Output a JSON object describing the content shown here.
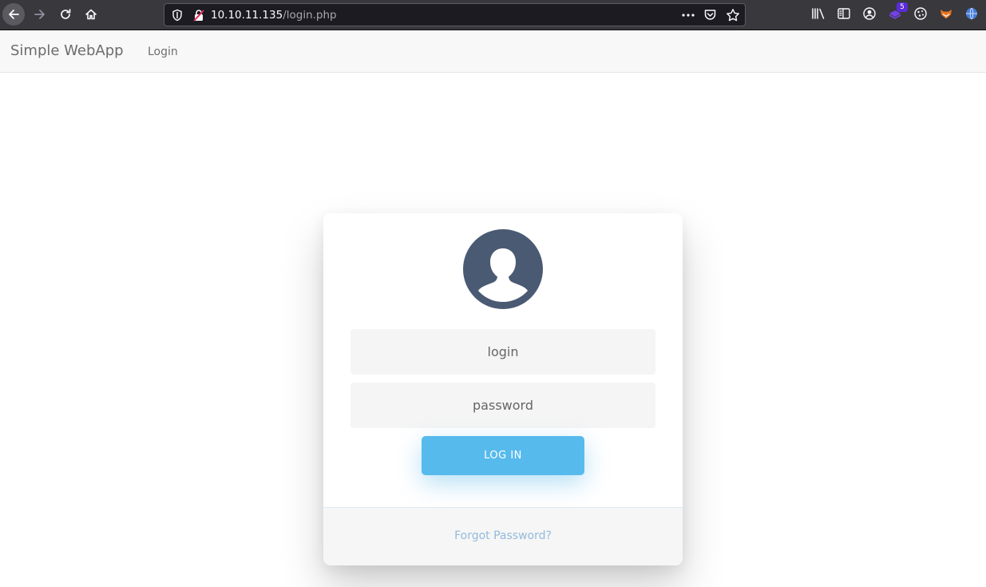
{
  "browser": {
    "url_host": "10.10.11.135",
    "url_path": "/login.php",
    "extension_badge": "5",
    "icons": {
      "back": "arrow-left-icon",
      "forward": "arrow-right-icon",
      "reload": "reload-icon",
      "home": "home-icon",
      "shield": "shield-icon",
      "lock": "insecure-lock-icon",
      "page_actions": "ellipsis-icon",
      "pocket": "pocket-icon",
      "bookmark": "star-icon",
      "library": "library-icon",
      "sidebar": "sidebar-icon",
      "account": "account-icon",
      "extension": "extension-icon",
      "cookie": "cookie-icon",
      "foxyproxy": "fox-icon",
      "globe": "globe-icon"
    }
  },
  "site": {
    "brand": "Simple WebApp",
    "nav_login": "Login"
  },
  "login": {
    "login_placeholder": "login",
    "password_placeholder": "password",
    "submit_label": "LOG IN",
    "forgot_label": "Forgot Password?",
    "avatar_icon": "user-avatar-icon"
  },
  "colors": {
    "accent": "#56baed",
    "avatar": "#4a5a73",
    "link": "#92badd"
  }
}
